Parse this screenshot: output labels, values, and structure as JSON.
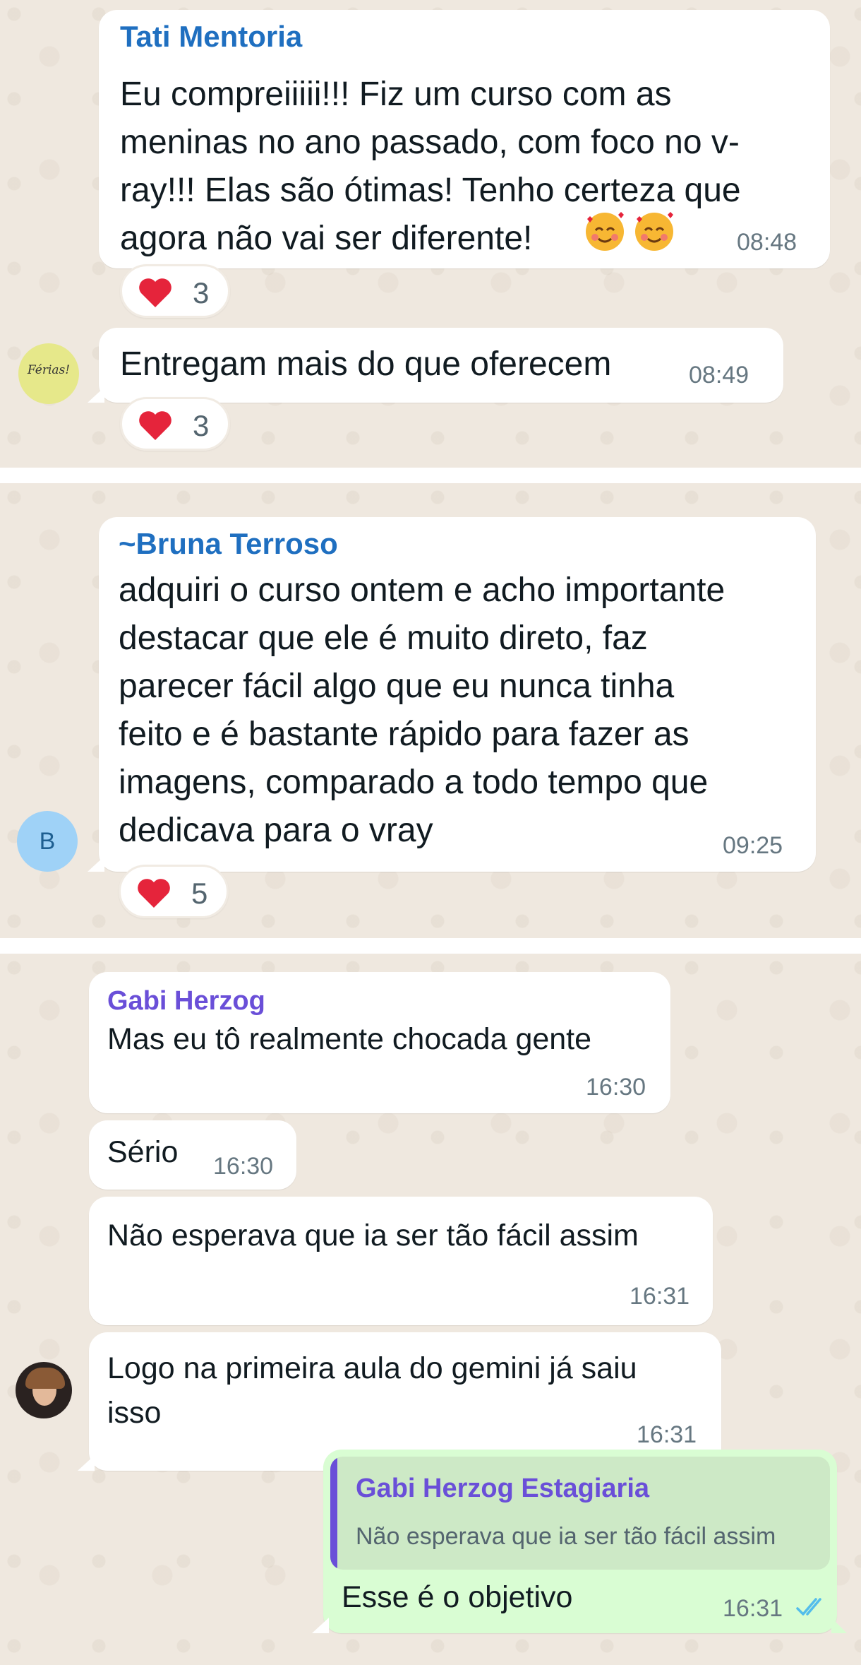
{
  "theme": {
    "bubble_in": "#ffffff",
    "bubble_out": "#d9fdd3",
    "chat_bg": "#efe8df",
    "sender_blue": "#1f6fc0",
    "sender_purple": "#6a4fd8",
    "read_check": "#53bdeb"
  },
  "section1": {
    "msg1": {
      "sender": "Tati Mentoria",
      "lines": [
        "Eu compreiiiii!!! Fiz um curso com as",
        "meninas no ano passado, com foco no v-",
        "ray!!! Elas são ótimas! Tenho certeza que",
        "agora não vai ser diferente!"
      ],
      "emoji": "smiling-face-with-hearts",
      "time": "08:48",
      "reaction": {
        "emoji": "red-heart",
        "count": "3"
      }
    },
    "msg2": {
      "avatar_text": "Férias!",
      "text": "Entregam mais do que oferecem",
      "time": "08:49",
      "reaction": {
        "emoji": "red-heart",
        "count": "3"
      }
    }
  },
  "section2": {
    "msg1": {
      "sender_prefix": "~",
      "sender": "Bruna Terroso",
      "lines": [
        "adquiri o curso ontem e acho importante",
        "destacar que ele é muito direto, faz",
        "parecer fácil algo que eu nunca tinha",
        "feito e é bastante rápido para fazer as",
        "imagens, comparado a todo tempo que",
        "dedicava para o vray"
      ],
      "time": "09:25",
      "avatar_letter": "B",
      "reaction": {
        "emoji": "red-heart",
        "count": "5"
      }
    }
  },
  "section3": {
    "msg1": {
      "sender": "Gabi Herzog",
      "text": "Mas eu tô realmente chocada gente",
      "time": "16:30"
    },
    "msg2": {
      "text": "Sério",
      "time": "16:30"
    },
    "msg3": {
      "text": "Não esperava que ia ser tão fácil assim",
      "time": "16:31"
    },
    "msg4": {
      "lines": [
        "Logo na primeira aula do gemini já saiu",
        "isso"
      ],
      "time": "16:31"
    },
    "reply": {
      "quoted_sender": "Gabi Herzog Estagiaria",
      "quoted_text": "Não esperava que ia ser tão fácil assim",
      "text": "Esse é o objetivo",
      "time": "16:31",
      "status": "read-double-check"
    }
  }
}
